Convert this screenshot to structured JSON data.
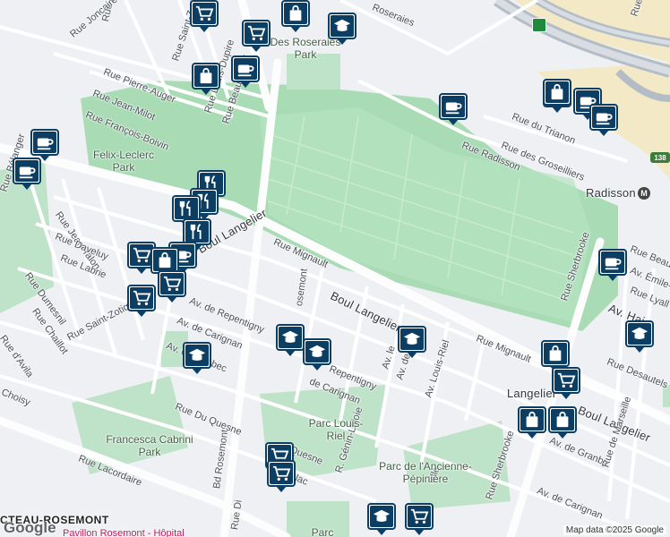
{
  "streets": {
    "beaubien_left": "Rue Beaubien",
    "joncaire": "Rue Joncaire",
    "saint_zotique_top": "Rue Saint-Zotiq",
    "roseraies": "Roseraies",
    "pierre_auger": "Rue Pierre-Auger",
    "jean_milot": "Rue Jean-Milot",
    "louis_dupire": "Rue Louis-Dupire",
    "beaubien_e": "Rue Beaubien E",
    "francois_boivin": "Rue François-Boivin",
    "du_trianon": "Rue du Trianon",
    "des_groseilliers": "Rue des Groseilliers",
    "radisson": "Rue Radisson",
    "belanger": "Rue Bélanger",
    "jean_talon": "Rue Jean-Talon",
    "daveluy": "Rue Daveluy",
    "labrie": "Rue Labrie",
    "dumesnil": "Rue Dumesnil",
    "chaillot": "Rue Chaillot",
    "davila": "Rue d'Avila",
    "saint_zotique": "Rue Saint-Zotique",
    "choisy": "Choisy",
    "boul_langelier_1": "Boul Langelier",
    "boul_langelier_2": "Boul Langelier",
    "boul_langelier_3": "Boul Langelier",
    "rue_mignault_1": "Rue Mignault",
    "rue_mignault_2": "Rue Mignault",
    "repentigny_1": "Av. de Repentigny",
    "repentigny_2": "Repentigny",
    "carignan_1": "Av. de Carignan",
    "carignan_2": "de Carignan",
    "carignan_3": "Av. de Carignan",
    "bd_rosemont_1": "osemont",
    "bd_rosemont_2": "Bd Rosemont",
    "bd_rosemont_3": "Rue Di",
    "quebec": "Av. de Quebec",
    "du_quesne": "Rue Du Quesne",
    "lacordaire": "Rue Lacordaire",
    "av_le": "Av. le",
    "av_de": "Av. de",
    "louis_riel": "Av. Louis-Riel",
    "genin_lajoie": "R. Génin-Lajoie",
    "quesne_2": "Quesne",
    "lac": "lac",
    "ville": "ville",
    "sherbrooke_1": "Rue Sherbrooke",
    "sherbrooke_2": "Rue Sherbrooke",
    "beau_e": "Rue Beau",
    "emile_legault": "Av. Émile-L",
    "lyall": "Rue Lyall",
    "haig": "Av. Hai",
    "desautels": "Rue Desautels",
    "granby": "Av. de Granby",
    "marseille": "Rue de Marseille",
    "av_de_carignan_br": "Av. de Carignan",
    "rue_p": "Rue P"
  },
  "parks": {
    "roseraies": "Des Roseraies Park",
    "felix_leclerc": "Felix-Leclerc Park",
    "francesca": "Francesca Cabrini Park",
    "louis_riel": "Parc Louis-Riel",
    "pepiniere": "Parc de l'Ancienne-Pépinière",
    "parc_bottom": "Parc"
  },
  "places": {
    "radisson": "Radisson",
    "langelier": "Langelier",
    "area": "CTEAU-ROSEMONT",
    "hopital": "Pavillon Rosemont - Hôpital",
    "hwy_number": "138"
  },
  "metro_icon": "M",
  "attribution": "Map data ©2025 Google",
  "logo": "Google",
  "markers": [
    {
      "type": "shopping-cart"
    },
    {
      "type": "shopping-bag"
    },
    {
      "type": "school"
    },
    {
      "type": "shopping-cart"
    },
    {
      "type": "shopping-bag"
    },
    {
      "type": "cafe"
    },
    {
      "type": "cafe"
    },
    {
      "type": "cafe"
    },
    {
      "type": "cafe"
    },
    {
      "type": "cafe"
    },
    {
      "type": "cafe"
    },
    {
      "type": "shopping-bag"
    },
    {
      "type": "cafe"
    },
    {
      "type": "restaurant"
    },
    {
      "type": "restaurant"
    },
    {
      "type": "restaurant"
    },
    {
      "type": "restaurant"
    },
    {
      "type": "cafe"
    },
    {
      "type": "shopping-cart"
    },
    {
      "type": "shopping-bag"
    },
    {
      "type": "shopping-cart"
    },
    {
      "type": "shopping-cart"
    },
    {
      "type": "cafe"
    },
    {
      "type": "school"
    },
    {
      "type": "school"
    },
    {
      "type": "school"
    },
    {
      "type": "school"
    },
    {
      "type": "school"
    },
    {
      "type": "shopping-bag"
    },
    {
      "type": "shopping-cart"
    },
    {
      "type": "shopping-bag"
    },
    {
      "type": "shopping-bag"
    },
    {
      "type": "shopping-cart"
    },
    {
      "type": "shopping-cart"
    },
    {
      "type": "school"
    },
    {
      "type": "shopping-cart"
    }
  ],
  "colors": {
    "background": "#eef0f3",
    "park": "#bfe3c8",
    "large_park": "#a9dcb5",
    "highway": "#b4bcc6",
    "marker": "#0c3d63",
    "sand": "#f3e9c6"
  }
}
